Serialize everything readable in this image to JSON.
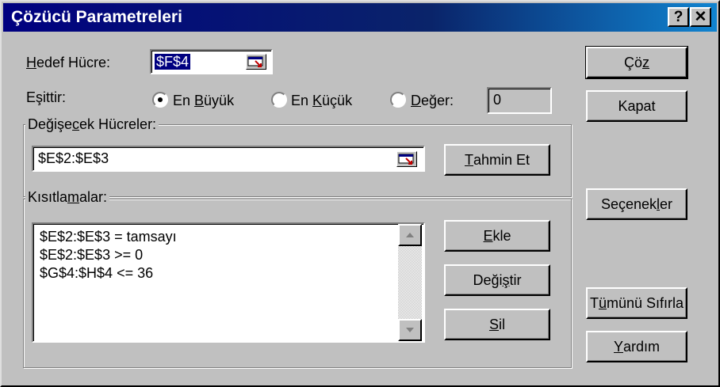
{
  "window": {
    "title": "Çözücü Parametreleri",
    "help_button": "?",
    "close_button": "✕"
  },
  "target_cell": {
    "label_pre": "H",
    "label_post": "edef Hücre:",
    "value": "$F$4"
  },
  "equal_to": {
    "label": "Eşittir:",
    "options": [
      {
        "pre": "En ",
        "u": "B",
        "post": "üyük",
        "selected": true
      },
      {
        "pre": "En ",
        "u": "K",
        "post": "üçük",
        "selected": false
      },
      {
        "pre": "",
        "u": "D",
        "post": "eğer:",
        "selected": false
      }
    ],
    "value": "0"
  },
  "changing_cells": {
    "label_pre": "Değişe",
    "label_u": "c",
    "label_post": "ek Hücreler:",
    "value": "$E$2:$E$3",
    "guess_pre": "",
    "guess_u": "T",
    "guess_post": "ahmin Et"
  },
  "constraints": {
    "label_pre": "Kısıtla",
    "label_u": "m",
    "label_post": "alar:",
    "items": [
      "$E$2:$E$3 = tamsayı",
      "$E$2:$E$3 >= 0",
      "$G$4:$H$4 <= 36"
    ],
    "add": {
      "pre": "",
      "u": "E",
      "post": "kle"
    },
    "change": {
      "pre": "Deği",
      "u": "ş",
      "post": "tir"
    },
    "delete": {
      "pre": "",
      "u": "S",
      "post": "il"
    }
  },
  "buttons": {
    "solve": {
      "pre": "Çö",
      "u": "z",
      "post": ""
    },
    "close": "Kapat",
    "options": {
      "pre": "Seçenek",
      "u": "l",
      "post": "er"
    },
    "reset": {
      "pre": "T",
      "u": "ü",
      "post": "münü Sıfırla"
    },
    "help": {
      "pre": "",
      "u": "Y",
      "post": "ardım"
    }
  }
}
